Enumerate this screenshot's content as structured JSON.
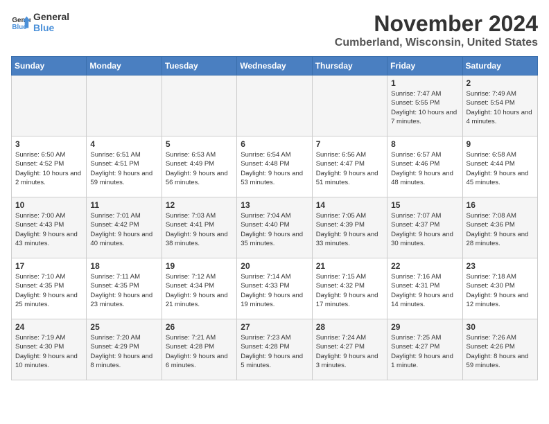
{
  "logo": {
    "text_general": "General",
    "text_blue": "Blue"
  },
  "title": "November 2024",
  "location": "Cumberland, Wisconsin, United States",
  "days_of_week": [
    "Sunday",
    "Monday",
    "Tuesday",
    "Wednesday",
    "Thursday",
    "Friday",
    "Saturday"
  ],
  "weeks": [
    [
      {
        "day": "",
        "info": ""
      },
      {
        "day": "",
        "info": ""
      },
      {
        "day": "",
        "info": ""
      },
      {
        "day": "",
        "info": ""
      },
      {
        "day": "",
        "info": ""
      },
      {
        "day": "1",
        "info": "Sunrise: 7:47 AM\nSunset: 5:55 PM\nDaylight: 10 hours and 7 minutes."
      },
      {
        "day": "2",
        "info": "Sunrise: 7:49 AM\nSunset: 5:54 PM\nDaylight: 10 hours and 4 minutes."
      }
    ],
    [
      {
        "day": "3",
        "info": "Sunrise: 6:50 AM\nSunset: 4:52 PM\nDaylight: 10 hours and 2 minutes."
      },
      {
        "day": "4",
        "info": "Sunrise: 6:51 AM\nSunset: 4:51 PM\nDaylight: 9 hours and 59 minutes."
      },
      {
        "day": "5",
        "info": "Sunrise: 6:53 AM\nSunset: 4:49 PM\nDaylight: 9 hours and 56 minutes."
      },
      {
        "day": "6",
        "info": "Sunrise: 6:54 AM\nSunset: 4:48 PM\nDaylight: 9 hours and 53 minutes."
      },
      {
        "day": "7",
        "info": "Sunrise: 6:56 AM\nSunset: 4:47 PM\nDaylight: 9 hours and 51 minutes."
      },
      {
        "day": "8",
        "info": "Sunrise: 6:57 AM\nSunset: 4:46 PM\nDaylight: 9 hours and 48 minutes."
      },
      {
        "day": "9",
        "info": "Sunrise: 6:58 AM\nSunset: 4:44 PM\nDaylight: 9 hours and 45 minutes."
      }
    ],
    [
      {
        "day": "10",
        "info": "Sunrise: 7:00 AM\nSunset: 4:43 PM\nDaylight: 9 hours and 43 minutes."
      },
      {
        "day": "11",
        "info": "Sunrise: 7:01 AM\nSunset: 4:42 PM\nDaylight: 9 hours and 40 minutes."
      },
      {
        "day": "12",
        "info": "Sunrise: 7:03 AM\nSunset: 4:41 PM\nDaylight: 9 hours and 38 minutes."
      },
      {
        "day": "13",
        "info": "Sunrise: 7:04 AM\nSunset: 4:40 PM\nDaylight: 9 hours and 35 minutes."
      },
      {
        "day": "14",
        "info": "Sunrise: 7:05 AM\nSunset: 4:39 PM\nDaylight: 9 hours and 33 minutes."
      },
      {
        "day": "15",
        "info": "Sunrise: 7:07 AM\nSunset: 4:37 PM\nDaylight: 9 hours and 30 minutes."
      },
      {
        "day": "16",
        "info": "Sunrise: 7:08 AM\nSunset: 4:36 PM\nDaylight: 9 hours and 28 minutes."
      }
    ],
    [
      {
        "day": "17",
        "info": "Sunrise: 7:10 AM\nSunset: 4:35 PM\nDaylight: 9 hours and 25 minutes."
      },
      {
        "day": "18",
        "info": "Sunrise: 7:11 AM\nSunset: 4:35 PM\nDaylight: 9 hours and 23 minutes."
      },
      {
        "day": "19",
        "info": "Sunrise: 7:12 AM\nSunset: 4:34 PM\nDaylight: 9 hours and 21 minutes."
      },
      {
        "day": "20",
        "info": "Sunrise: 7:14 AM\nSunset: 4:33 PM\nDaylight: 9 hours and 19 minutes."
      },
      {
        "day": "21",
        "info": "Sunrise: 7:15 AM\nSunset: 4:32 PM\nDaylight: 9 hours and 17 minutes."
      },
      {
        "day": "22",
        "info": "Sunrise: 7:16 AM\nSunset: 4:31 PM\nDaylight: 9 hours and 14 minutes."
      },
      {
        "day": "23",
        "info": "Sunrise: 7:18 AM\nSunset: 4:30 PM\nDaylight: 9 hours and 12 minutes."
      }
    ],
    [
      {
        "day": "24",
        "info": "Sunrise: 7:19 AM\nSunset: 4:30 PM\nDaylight: 9 hours and 10 minutes."
      },
      {
        "day": "25",
        "info": "Sunrise: 7:20 AM\nSunset: 4:29 PM\nDaylight: 9 hours and 8 minutes."
      },
      {
        "day": "26",
        "info": "Sunrise: 7:21 AM\nSunset: 4:28 PM\nDaylight: 9 hours and 6 minutes."
      },
      {
        "day": "27",
        "info": "Sunrise: 7:23 AM\nSunset: 4:28 PM\nDaylight: 9 hours and 5 minutes."
      },
      {
        "day": "28",
        "info": "Sunrise: 7:24 AM\nSunset: 4:27 PM\nDaylight: 9 hours and 3 minutes."
      },
      {
        "day": "29",
        "info": "Sunrise: 7:25 AM\nSunset: 4:27 PM\nDaylight: 9 hours and 1 minute."
      },
      {
        "day": "30",
        "info": "Sunrise: 7:26 AM\nSunset: 4:26 PM\nDaylight: 8 hours and 59 minutes."
      }
    ]
  ]
}
